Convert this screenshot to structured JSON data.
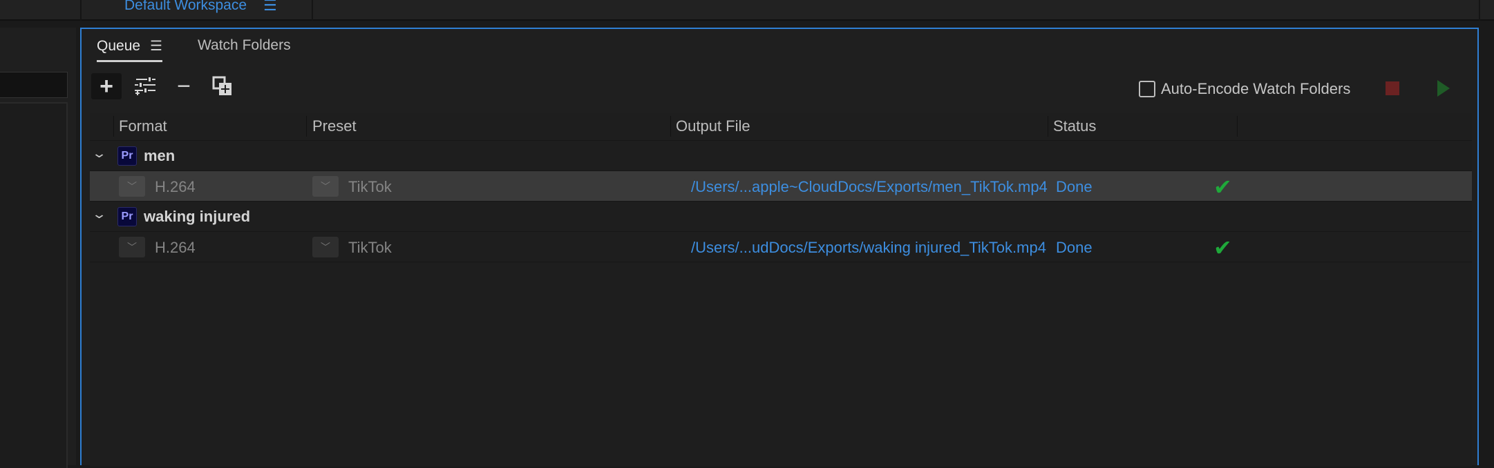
{
  "header": {
    "workspace_label": "Default Workspace",
    "workspace_menu_icon": "hamburger-icon"
  },
  "tabs": [
    {
      "label": "Queue",
      "active": true
    },
    {
      "label": "Watch Folders",
      "active": false
    }
  ],
  "toolbar": {
    "buttons": [
      "add-source-icon",
      "preset-settings-icon",
      "remove-icon",
      "duplicate-icon"
    ],
    "auto_encode_label": "Auto-Encode Watch Folders",
    "auto_encode_checked": false,
    "stop_icon": "stop-icon",
    "play_icon": "play-icon"
  },
  "table": {
    "columns": [
      "Format",
      "Preset",
      "Output File",
      "Status"
    ],
    "groups": [
      {
        "app_badge": "Pr",
        "name": "men",
        "item": {
          "format": "H.264",
          "preset": "TikTok",
          "output": "/Users/...apple~CloudDocs/Exports/men_TikTok.mp4",
          "status": "Done",
          "selected": true
        }
      },
      {
        "app_badge": "Pr",
        "name": "waking injured",
        "item": {
          "format": "H.264",
          "preset": "TikTok",
          "output": "/Users/...udDocs/Exports/waking injured_TikTok.mp4",
          "status": "Done",
          "selected": false
        }
      }
    ]
  },
  "colors": {
    "accent_blue": "#3d8ee0",
    "done_check": "#1fa83a",
    "stop_red": "#6b2222",
    "play_green": "#1f5c27",
    "pr_badge_bg": "#08083a"
  }
}
